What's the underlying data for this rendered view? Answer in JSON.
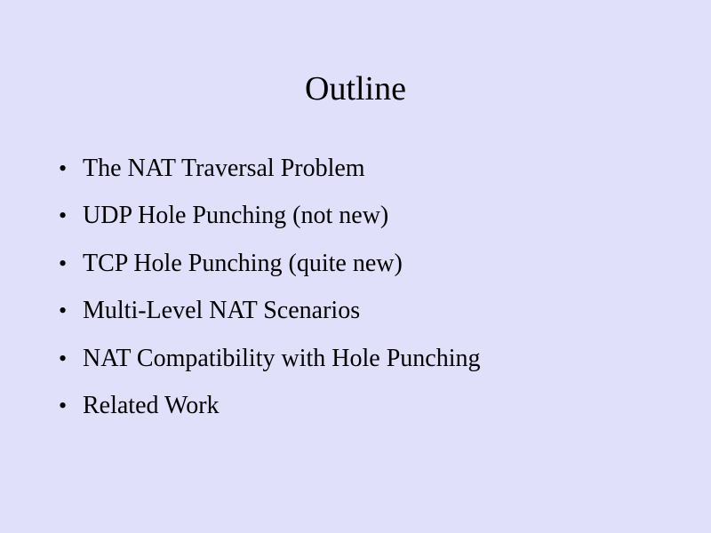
{
  "slide": {
    "title": "Outline",
    "background_color": "#e0e0fa",
    "bullet_symbol": "•",
    "bullets": [
      "The NAT Traversal Problem",
      "UDP Hole Punching (not new)",
      "TCP Hole Punching (quite new)",
      "Multi-Level NAT Scenarios",
      "NAT Compatibility with Hole Punching",
      "Related Work"
    ]
  }
}
